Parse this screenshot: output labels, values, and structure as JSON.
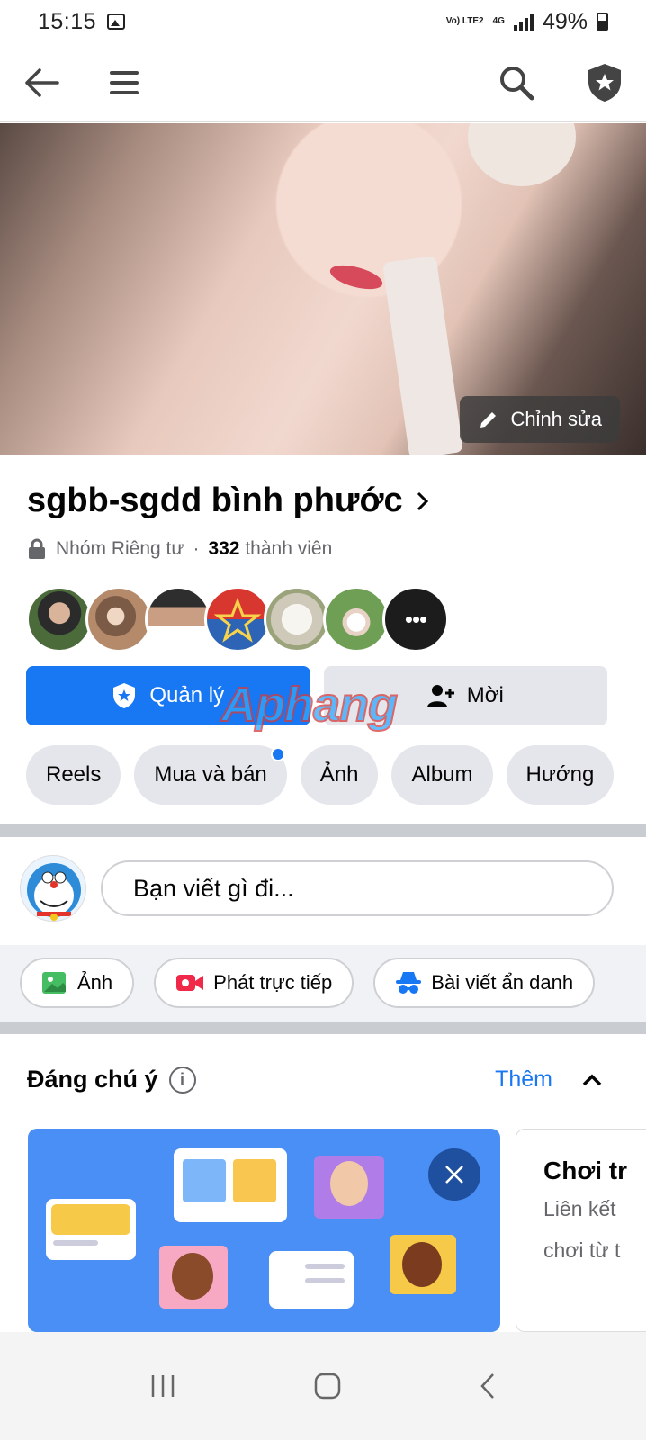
{
  "status": {
    "time": "15:15",
    "network": "Vo) LTE2",
    "network_type": "4G",
    "battery": "49%"
  },
  "group": {
    "name": "sgbb-sgdd bình phước",
    "privacy": "Nhóm Riêng tư",
    "separator": "·",
    "member_count": "332",
    "member_label": "thành viên",
    "edit_label": "Chỉnh sửa",
    "members_more": "•••"
  },
  "actions": {
    "manage_label": "Quản lý",
    "invite_label": "Mời",
    "watermark": "Aphang"
  },
  "chips": [
    "Reels",
    "Mua và bán",
    "Ảnh",
    "Album",
    "Hướng"
  ],
  "composer": {
    "placeholder": "Bạn viết gì đi..."
  },
  "post_actions": [
    "Ảnh",
    "Phát trực tiếp",
    "Bài viết ẩn danh"
  ],
  "featured": {
    "title": "Đáng chú ý",
    "more_label": "Thêm",
    "side_card": {
      "title": "Chơi tr",
      "line1": "Liên kết",
      "line2": "chơi từ t"
    }
  },
  "colors": {
    "primary": "#1877f2",
    "chip_bg": "#e4e6eb",
    "divider": "#c9ccd1"
  }
}
